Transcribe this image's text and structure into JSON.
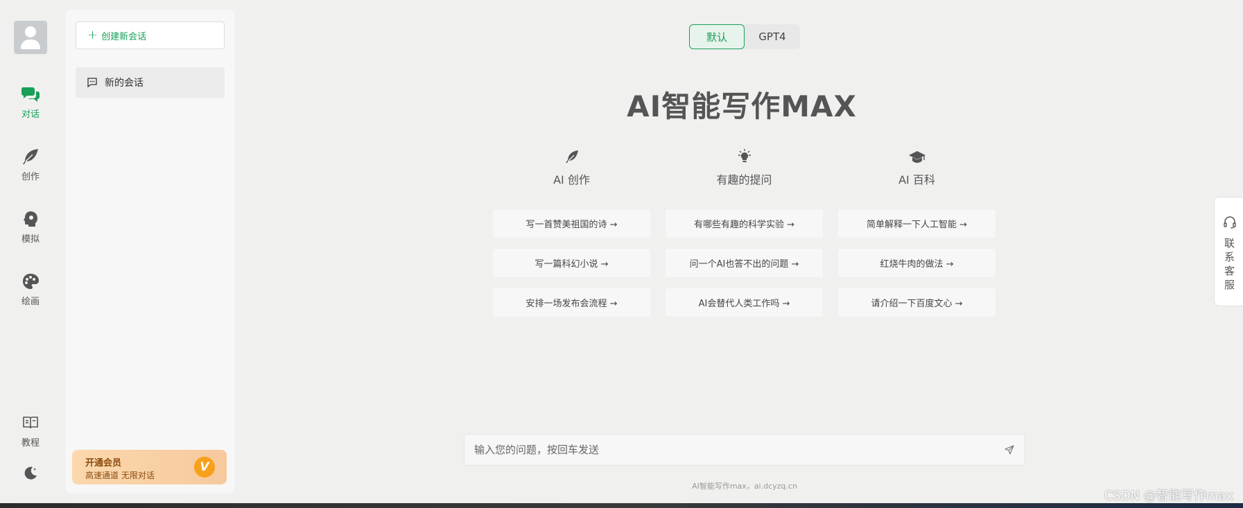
{
  "nav": {
    "items": [
      {
        "label": "对话",
        "icon": "chat-bubbles-icon",
        "active": true
      },
      {
        "label": "创作",
        "icon": "feather-icon"
      },
      {
        "label": "模拟",
        "icon": "head-profile-icon"
      },
      {
        "label": "绘画",
        "icon": "palette-icon"
      },
      {
        "label": "教程",
        "icon": "open-book-icon"
      }
    ],
    "theme_icon": "moon-icon"
  },
  "sidebar": {
    "new_chat_label": "创建新会话",
    "conversations": [
      "新的会话"
    ],
    "member": {
      "title": "开通会员",
      "subtitle": "高速通道 无限对话",
      "badge": "V"
    }
  },
  "model_switch": {
    "options": [
      "默认",
      "GPT4"
    ],
    "selected": "默认"
  },
  "main": {
    "title": "AI智能写作MAX",
    "columns": [
      {
        "heading": "AI 创作",
        "icon": "feather-icon",
        "prompts": [
          "写一首赞美祖国的诗 →",
          "写一篇科幻小说 →",
          "安排一场发布会流程 →"
        ]
      },
      {
        "heading": "有趣的提问",
        "icon": "lightbulb-icon",
        "prompts": [
          "有哪些有趣的科学实验 →",
          "问一个AI也答不出的问题 →",
          "AI会替代人类工作吗 →"
        ]
      },
      {
        "heading": "AI 百科",
        "icon": "graduation-cap-icon",
        "prompts": [
          "简单解释一下人工智能 →",
          "红烧牛肉的做法 →",
          "请介绍一下百度文心 →"
        ]
      }
    ]
  },
  "input": {
    "placeholder": "输入您的问题，按回车发送",
    "value": ""
  },
  "footer": "AI智能写作max，ai.dcyzq.cn",
  "support": {
    "label": "联系客服"
  },
  "watermark": "CSDN @智能写作max",
  "colors": {
    "accent": "#18a058",
    "background": "#f0f0ef",
    "member_gradient": "#fbd8ac"
  }
}
